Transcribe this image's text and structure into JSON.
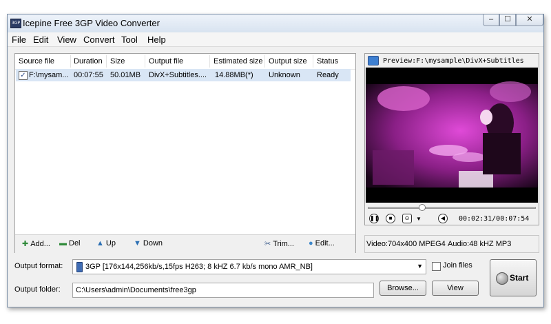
{
  "window": {
    "title": "Icepine Free 3GP Video Converter"
  },
  "menu": [
    "File",
    "Edit",
    "View",
    "Convert",
    "Tool",
    "Help"
  ],
  "table": {
    "columns": [
      "Source file",
      "Duration",
      "Size",
      "Output file",
      "Estimated size",
      "Output size",
      "Status"
    ],
    "rows": [
      {
        "checked": true,
        "cells": [
          "F:\\mysam...",
          "00:07:55",
          "50.01MB",
          "DivX+Subtitles....",
          "14.88MB(*)",
          "Unknown",
          "Ready"
        ]
      }
    ]
  },
  "file_toolbar": {
    "add": "Add...",
    "del": "Del",
    "up": "Up",
    "down": "Down",
    "trim": "Trim...",
    "edit": "Edit..."
  },
  "preview": {
    "title": "Preview:F:\\mysample\\DivX+Subtitles",
    "time": "00:02:31/00:07:54",
    "progress": 0.32
  },
  "info": {
    "video": "Video:704x400 MPEG4",
    "audio": "Audio:48 kHZ MP3"
  },
  "output": {
    "format_label": "Output format:",
    "format_value": "3GP [176x144,256kb/s,15fps H263;  8 kHZ 6.7 kb/s mono AMR_NB]",
    "folder_label": "Output folder:",
    "folder_value": "C:\\Users\\admin\\Documents\\free3gp",
    "join_files": "Join files",
    "browse": "Browse...",
    "view": "View",
    "start": "Start"
  }
}
